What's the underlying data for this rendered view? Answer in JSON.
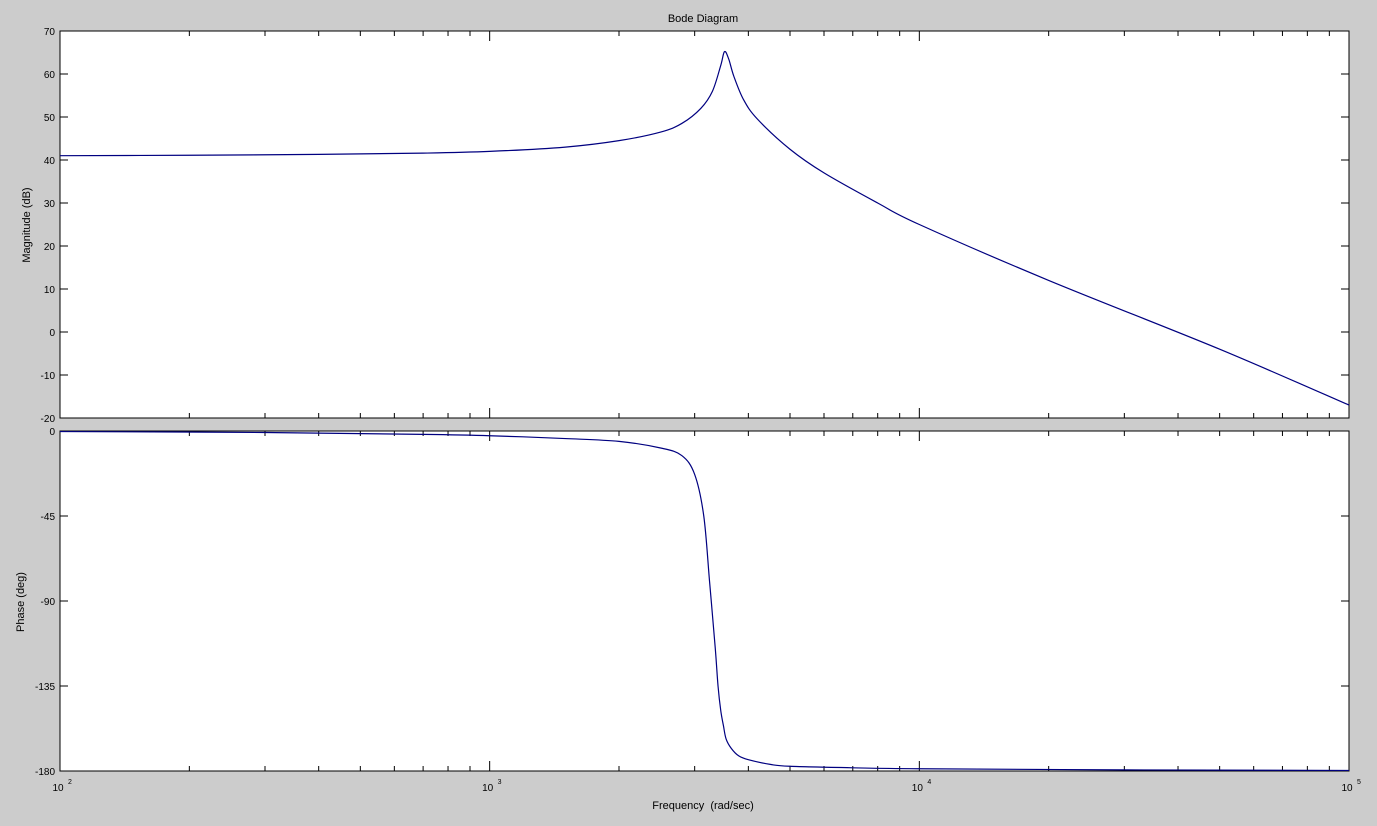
{
  "figure": {
    "title": "Bode Diagram",
    "background": "#cccccc",
    "axes_background": "#ffffff",
    "line_color": "#000080"
  },
  "chart_data": [
    {
      "type": "line",
      "name": "magnitude",
      "title": "Bode Diagram",
      "ylabel": "Magnitude (dB)",
      "xlabel": "",
      "xscale": "log",
      "xlim": [
        100,
        100000
      ],
      "ylim": [
        -20,
        70
      ],
      "yticks": [
        -20,
        -10,
        0,
        10,
        20,
        30,
        40,
        50,
        60,
        70
      ],
      "ytick_labels": [
        "-20",
        "-10",
        "0",
        "10",
        "20",
        "30",
        "40",
        "50",
        "60",
        "70"
      ],
      "grid": false,
      "series": [
        {
          "x": [
            100,
            200,
            400,
            700,
            1000,
            1500,
            2000,
            2500,
            2800,
            3100,
            3300,
            3450,
            3520,
            3600,
            3700,
            3900,
            4200,
            5000,
            6000,
            8000,
            10000,
            20000,
            50000,
            100000
          ],
          "y": [
            41,
            41.1,
            41.3,
            41.6,
            42,
            43,
            44.5,
            46.5,
            48.5,
            52,
            56,
            62,
            65.2,
            63.5,
            59.5,
            54,
            49.5,
            42.5,
            37,
            30,
            25,
            12,
            -4,
            -17
          ]
        }
      ]
    },
    {
      "type": "line",
      "name": "phase",
      "ylabel": "Phase (deg)",
      "xlabel": "Frequency  (rad/sec)",
      "xscale": "log",
      "xlim": [
        100,
        100000
      ],
      "ylim": [
        -180,
        0
      ],
      "yticks": [
        -180,
        -135,
        -90,
        -45,
        0
      ],
      "ytick_labels": [
        "-180",
        "-135",
        "-90",
        "-45",
        "0"
      ],
      "xtick_labels": [
        {
          "base": "10",
          "exp": "2"
        },
        {
          "base": "10",
          "exp": "3"
        },
        {
          "base": "10",
          "exp": "4"
        },
        {
          "base": "10",
          "exp": "5"
        }
      ],
      "grid": false,
      "series": [
        {
          "x": [
            100,
            300,
            700,
            1000,
            1500,
            2000,
            2500,
            2800,
            3000,
            3150,
            3250,
            3350,
            3400,
            3450,
            3500,
            3550,
            3650,
            3800,
            4000,
            4500,
            5000,
            7000,
            10000,
            30000,
            100000
          ],
          "y": [
            -0.3,
            -0.8,
            -1.8,
            -2.5,
            -4,
            -5.5,
            -9,
            -13,
            -23,
            -45,
            -80,
            -115,
            -135,
            -148,
            -156,
            -163,
            -168,
            -172,
            -174,
            -176.5,
            -177.5,
            -178.3,
            -178.8,
            -179.4,
            -179.7
          ]
        }
      ]
    }
  ]
}
